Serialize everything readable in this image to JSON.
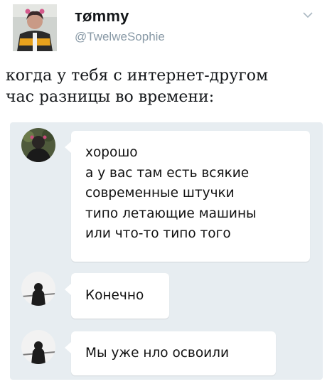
{
  "tweet": {
    "author": {
      "display_name": "тømmy",
      "handle": "@TwelweSophie",
      "avatar_icon": "person-avatar-icon"
    },
    "menu_icon": "chevron-down-icon",
    "text_lines": [
      "когда у тебя с интернет-другом",
      "час разницы во времени:"
    ]
  },
  "chat": {
    "background": "#e7edf1",
    "messages": [
      {
        "sender": "friend",
        "avatar_icon": "friend-avatar-icon",
        "lines": [
          "хорошо",
          "а у вас там есть всякие",
          "современные штучки",
          "типо летающие машины",
          "или что-то типо того"
        ]
      },
      {
        "sender": "future-friend",
        "avatar_icon": "hooded-figure-avatar-icon",
        "lines": [
          "Конечно"
        ]
      },
      {
        "sender": "future-friend",
        "avatar_icon": "hooded-figure-avatar-icon",
        "lines": [
          "Мы уже нло освоили"
        ]
      }
    ]
  }
}
